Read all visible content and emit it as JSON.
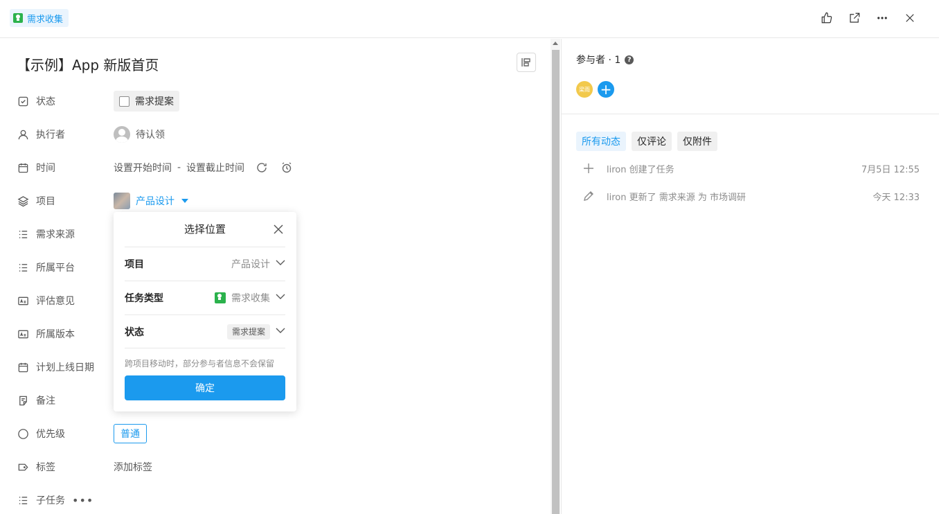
{
  "header": {
    "type_label": "需求收集"
  },
  "task": {
    "title": "【示例】App 新版首页",
    "fields": {
      "status": {
        "label": "状态",
        "value": "需求提案"
      },
      "assignee": {
        "label": "执行者",
        "value": "待认领"
      },
      "time": {
        "label": "时间",
        "start": "设置开始时间",
        "separator": "-",
        "end": "设置截止时间"
      },
      "project": {
        "label": "项目",
        "value": "产品设计"
      },
      "source": {
        "label": "需求来源"
      },
      "platform": {
        "label": "所属平台"
      },
      "review": {
        "label": "评估意见"
      },
      "version": {
        "label": "所属版本"
      },
      "launch_date": {
        "label": "计划上线日期"
      },
      "notes": {
        "label": "备注"
      },
      "priority": {
        "label": "优先级",
        "value": "普通"
      },
      "tags": {
        "label": "标签",
        "value": "添加标签"
      },
      "subtasks": {
        "label": "子任务",
        "more": "•••"
      }
    }
  },
  "popover": {
    "title": "选择位置",
    "rows": [
      {
        "label": "项目",
        "value": "产品设计"
      },
      {
        "label": "任务类型",
        "value": "需求收集"
      },
      {
        "label": "状态",
        "value": "需求提案"
      }
    ],
    "hint": "跨项目移动时，部分参与者信息不会保留",
    "confirm": "确定"
  },
  "sidebar": {
    "participants_label": "参与者 · 1",
    "help_glyph": "?",
    "avatar_text": "梁雨",
    "add_glyph": "+",
    "tabs": [
      {
        "label": "所有动态",
        "active": true
      },
      {
        "label": "仅评论",
        "active": false
      },
      {
        "label": "仅附件",
        "active": false
      }
    ],
    "activities": [
      {
        "text": "liron 创建了任务",
        "time": "7月5日 12:55",
        "icon": "plus-icon"
      },
      {
        "text": "liron 更新了 需求来源 为 市场调研",
        "time": "今天 12:33",
        "icon": "pencil-icon"
      }
    ]
  },
  "colors": {
    "accent": "#1b9aee",
    "type_green": "#2bb24c",
    "avatar_yellow": "#f2c94c"
  }
}
